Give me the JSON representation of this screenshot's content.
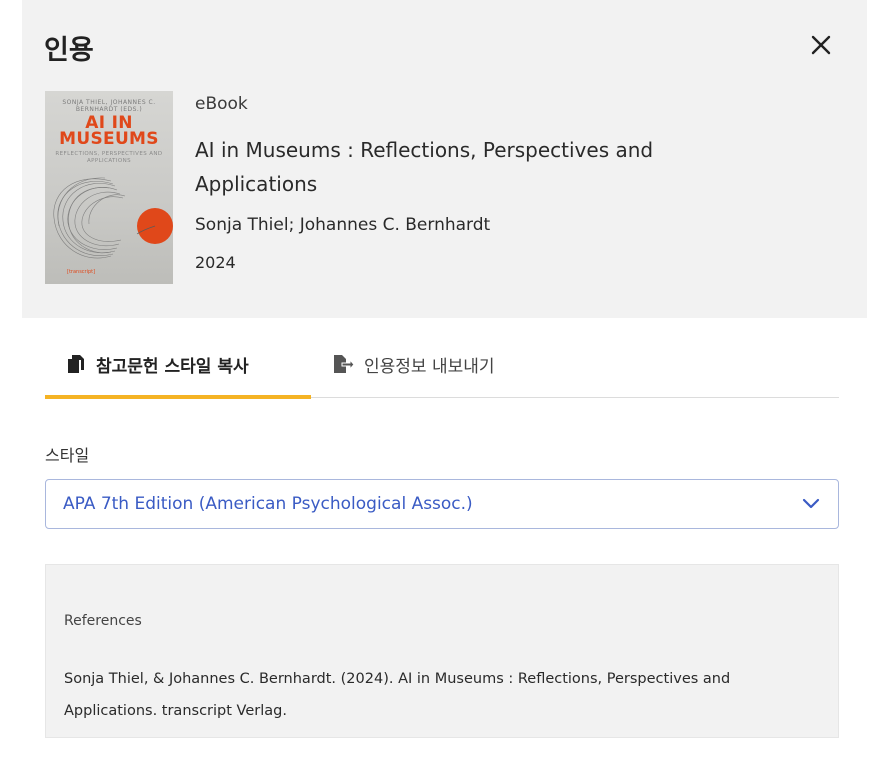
{
  "dialog": {
    "title": "인용"
  },
  "book": {
    "type": "eBook",
    "title": "AI in Museums : Reflections, Perspectives and Applications",
    "authors": "Sonja Thiel; Johannes C. Bernhardt",
    "year": "2024",
    "cover": {
      "author_text": "SONJA THIEL, JOHANNES C. BERNHARDT (EDS.)",
      "title_line1": "AI IN",
      "title_line2": "MUSEUMS",
      "subtitle_text": "REFLECTIONS, PERSPECTIVES AND APPLICATIONS",
      "publisher_text": "[transcript]",
      "accent_color": "#e0481a"
    }
  },
  "tabs": [
    {
      "label": "참고문헌 스타일 복사",
      "icon": "copy-document-icon",
      "active": true
    },
    {
      "label": "인용정보 내보내기",
      "icon": "export-document-icon",
      "active": false
    }
  ],
  "style_selector": {
    "label": "스타일",
    "selected": "APA 7th Edition (American Psychological Assoc.)"
  },
  "references": {
    "heading": "References",
    "citation": "Sonja Thiel, & Johannes C. Bernhardt. (2024). AI in Museums : Reflections, Perspectives and Applications. transcript Verlag."
  },
  "colors": {
    "accent_tab": "#f5b324",
    "link_blue": "#3a5bc4",
    "panel_bg": "#f2f2f2"
  }
}
